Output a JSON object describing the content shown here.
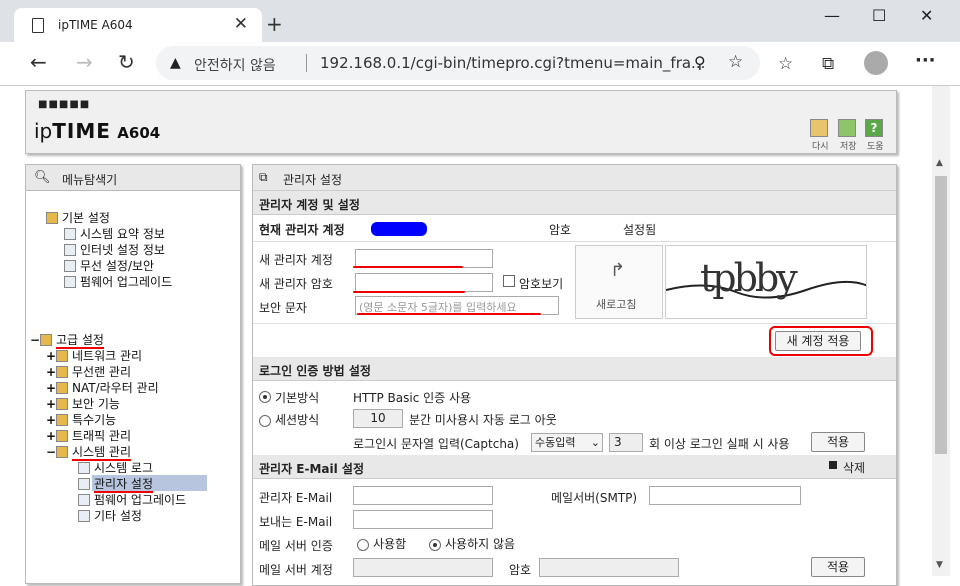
{
  "browser": {
    "tab_title": "ipTIME A604",
    "security_label": "안전하지 않음",
    "url": "192.168.0.1/cgi-bin/timepro.cgi?tmenu=main_fra..."
  },
  "header": {
    "logo_dots": "■■■■■",
    "logo_ip": "ip",
    "logo_time": "TIME",
    "logo_model": "A604",
    "buttons": [
      "다시",
      "저장",
      "도움"
    ]
  },
  "menu": {
    "title": "메뉴탐색기",
    "basic": {
      "label": "기본 설정",
      "items": [
        "시스템 요약 정보",
        "인터넷 설정 정보",
        "무선 설정/보안",
        "펌웨어 업그레이드"
      ]
    },
    "advanced": {
      "label": "고급 설정",
      "items": [
        "네트워크 관리",
        "무선랜 관리",
        "NAT/라우터 관리",
        "보안 기능",
        "특수기능",
        "트래픽 관리",
        "시스템 관리"
      ]
    },
    "system_items": [
      "시스템 로그",
      "관리자 설정",
      "펌웨어 업그레이드",
      "기타 설정"
    ]
  },
  "content": {
    "title": "관리자 설정",
    "section_account": "관리자 계정 및 설정",
    "current_account_label": "현재 관리자 계정",
    "password_label": "암호",
    "password_status": "설정됨",
    "new_account_label": "새 관리자 계정",
    "new_password_label": "새 관리자 암호",
    "show_password_label": "암호보기",
    "captcha_label": "보안 문자",
    "captcha_placeholder": "(영문 소문자 5글자)를 입력하세요",
    "refresh_label": "새로고침",
    "captcha_text": "tpbby",
    "apply_account_button": "새 계정 적용",
    "section_login": "로그인 인증 방법 설정",
    "basic_method": "기본방식",
    "basic_method_desc": "HTTP Basic 인증 사용",
    "session_method": "세션방식",
    "session_minutes": "10",
    "session_desc": "분간 미사용시 자동 로그 아웃",
    "captcha_login_label": "로그인시 문자열 입력(Captcha)",
    "captcha_mode": "수동입력",
    "captcha_count": "3",
    "captcha_fail_desc": "회 이상 로그인 실패 시 사용",
    "apply_button": "적용",
    "section_email": "관리자 E-Mail 설정",
    "delete_label": "삭제",
    "admin_email_label": "관리자 E-Mail",
    "smtp_label": "메일서버(SMTP)",
    "sender_email_label": "보내는 E-Mail",
    "mail_auth_label": "메일 서버 인증",
    "auth_use": "사용함",
    "auth_nouse": "사용하지 않음",
    "mail_account_label": "메일 서버 계정",
    "mail_password_label": "암호"
  }
}
